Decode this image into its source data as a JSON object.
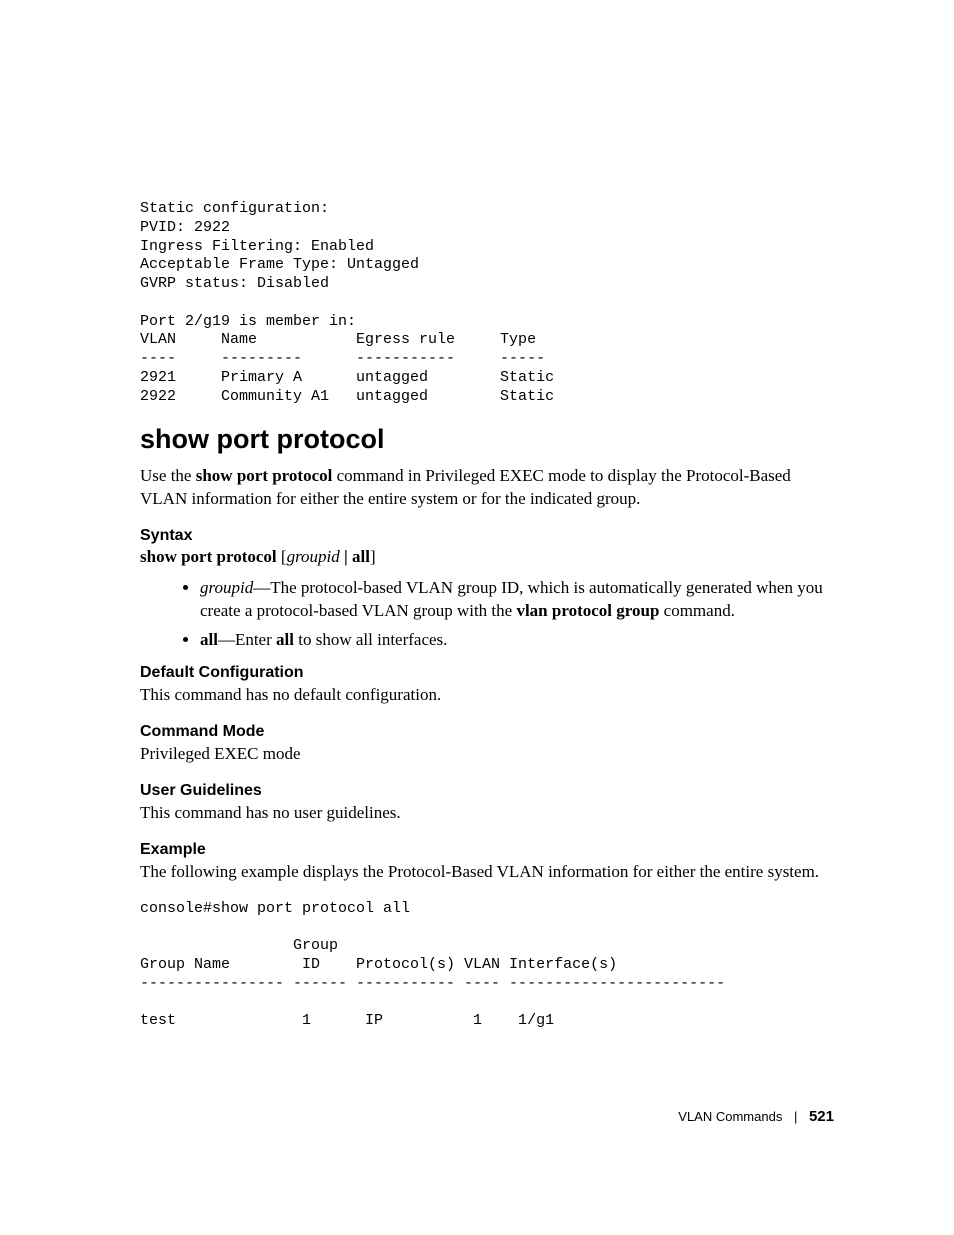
{
  "code_block_1": "Static configuration:\nPVID: 2922\nIngress Filtering: Enabled\nAcceptable Frame Type: Untagged\nGVRP status: Disabled\n\nPort 2/g19 is member in:\nVLAN     Name           Egress rule     Type\n----     ---------      -----------     -----\n2921     Primary A      untagged        Static\n2922     Community A1   untagged        Static",
  "section_title": "show port protocol",
  "intro": {
    "pre": "Use the ",
    "cmd": "show port protocol",
    "post": " command in Privileged EXEC mode to display the Protocol-Based VLAN information for either the entire system or for the indicated group."
  },
  "syntax": {
    "heading": "Syntax",
    "line": {
      "cmd": "show port protocol",
      "open": " [",
      "arg": "groupid",
      "sep": " | ",
      "all": "all",
      "close": "]"
    },
    "bullets": {
      "b1": {
        "term": "groupid",
        "dash": "—The protocol-based VLAN group ID, which is automatically generated when you create a protocol-based VLAN group with the ",
        "cmd": "vlan protocol group",
        "tail": " command."
      },
      "b2": {
        "term": "all",
        "dash": "—Enter ",
        "all2": "all",
        "tail": " to show all interfaces."
      }
    }
  },
  "default_config": {
    "heading": "Default Configuration",
    "text": "This command has no default configuration."
  },
  "command_mode": {
    "heading": "Command Mode",
    "text": "Privileged EXEC mode"
  },
  "user_guidelines": {
    "heading": "User Guidelines",
    "text": "This command has no user guidelines."
  },
  "example": {
    "heading": "Example",
    "text": "The following example displays the Protocol-Based VLAN information for either the entire system."
  },
  "code_block_2": "console#show port protocol all\n\n                 Group\nGroup Name        ID    Protocol(s) VLAN Interface(s)\n---------------- ------ ----------- ---- ------------------------\n\ntest              1      IP          1    1/g1",
  "footer": {
    "chapter": "VLAN Commands",
    "page": "521"
  }
}
